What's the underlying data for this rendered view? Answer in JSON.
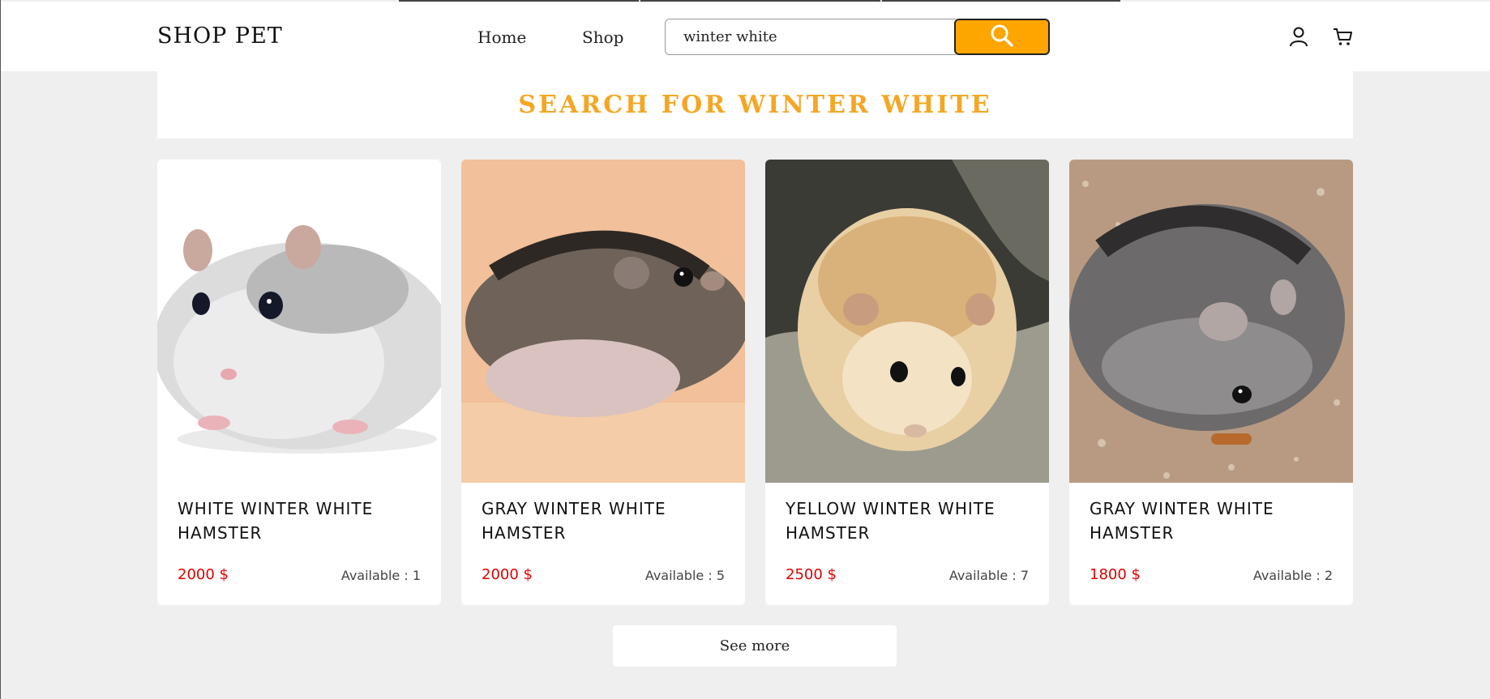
{
  "header": {
    "logo": "SHOP PET",
    "nav": {
      "home": "Home",
      "shop": "Shop"
    },
    "search": {
      "value": "winter white",
      "icon": "search-icon"
    },
    "icons": [
      "user-icon",
      "cart-icon"
    ],
    "accent_color": "#ffa500"
  },
  "banner": {
    "title": "SEARCH FOR WINTER WHITE",
    "color": "#f5a623"
  },
  "products": [
    {
      "name": "WHITE WINTER WHITE HAMSTER",
      "price": "2000 $",
      "stock": "Available : 1"
    },
    {
      "name": "GRAY WINTER WHITE HAMSTER",
      "price": "2000 $",
      "stock": "Available : 5"
    },
    {
      "name": "YELLOW WINTER WHITE HAMSTER",
      "price": "2500 $",
      "stock": "Available : 7"
    },
    {
      "name": "GRAY WINTER WHITE HAMSTER",
      "price": "1800 $",
      "stock": "Available : 2"
    }
  ],
  "see_more": "See more",
  "price_color": "#e00000"
}
